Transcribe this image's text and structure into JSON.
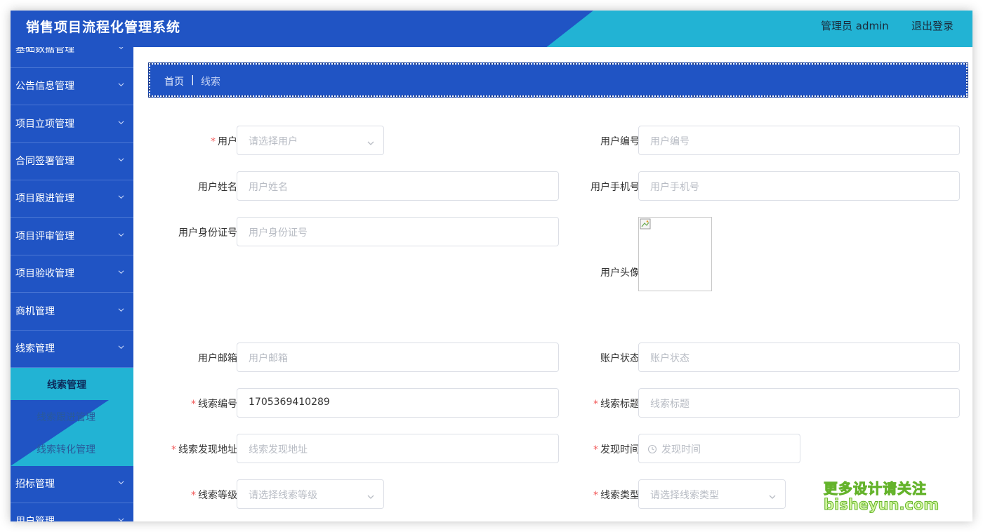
{
  "header": {
    "title": "销售项目流程化管理系统",
    "user": "管理员 admin",
    "logout": "退出登录"
  },
  "sidebar": {
    "items": [
      {
        "label": "基础数据管理"
      },
      {
        "label": "公告信息管理"
      },
      {
        "label": "项目立项管理"
      },
      {
        "label": "合同签署管理"
      },
      {
        "label": "项目跟进管理"
      },
      {
        "label": "项目评审管理"
      },
      {
        "label": "项目验收管理"
      },
      {
        "label": "商机管理"
      },
      {
        "label": "线索管理"
      },
      {
        "label": "招标管理"
      },
      {
        "label": "用户管理"
      }
    ],
    "submenu": [
      {
        "label": "线索管理",
        "active": true
      },
      {
        "label": "线索跟进管理"
      },
      {
        "label": "线索转化管理"
      }
    ]
  },
  "breadcrumb": {
    "home": "首页",
    "separator": "|",
    "current": "线索"
  },
  "form": {
    "user": {
      "label": "用户",
      "placeholder": "请选择用户",
      "required": true
    },
    "user_no": {
      "label": "用户编号",
      "placeholder": "用户编号"
    },
    "user_name": {
      "label": "用户姓名",
      "placeholder": "用户姓名"
    },
    "user_phone": {
      "label": "用户手机号",
      "placeholder": "用户手机号"
    },
    "user_id_card": {
      "label": "用户身份证号",
      "placeholder": "用户身份证号"
    },
    "user_avatar": {
      "label": "用户头像"
    },
    "user_email": {
      "label": "用户邮箱",
      "placeholder": "用户邮箱"
    },
    "account_status": {
      "label": "账户状态",
      "placeholder": "账户状态"
    },
    "clue_no": {
      "label": "线索编号",
      "value": "1705369410289",
      "required": true
    },
    "clue_title": {
      "label": "线索标题",
      "placeholder": "线索标题",
      "required": true
    },
    "clue_address": {
      "label": "线索发现地址",
      "placeholder": "线索发现地址",
      "required": true
    },
    "found_time": {
      "label": "发现时间",
      "placeholder": "发现时间",
      "required": true
    },
    "clue_level": {
      "label": "线索等级",
      "placeholder": "请选择线索等级",
      "required": true
    },
    "clue_type": {
      "label": "线索类型",
      "placeholder": "请选择线索类型",
      "required": true
    }
  },
  "watermark": {
    "line1": "更多设计请关注",
    "line2": "bisheyun.com"
  },
  "colors": {
    "primary_blue": "#2054c4",
    "accent_cyan": "#22b3d4",
    "required_red": "#f25a5a"
  }
}
